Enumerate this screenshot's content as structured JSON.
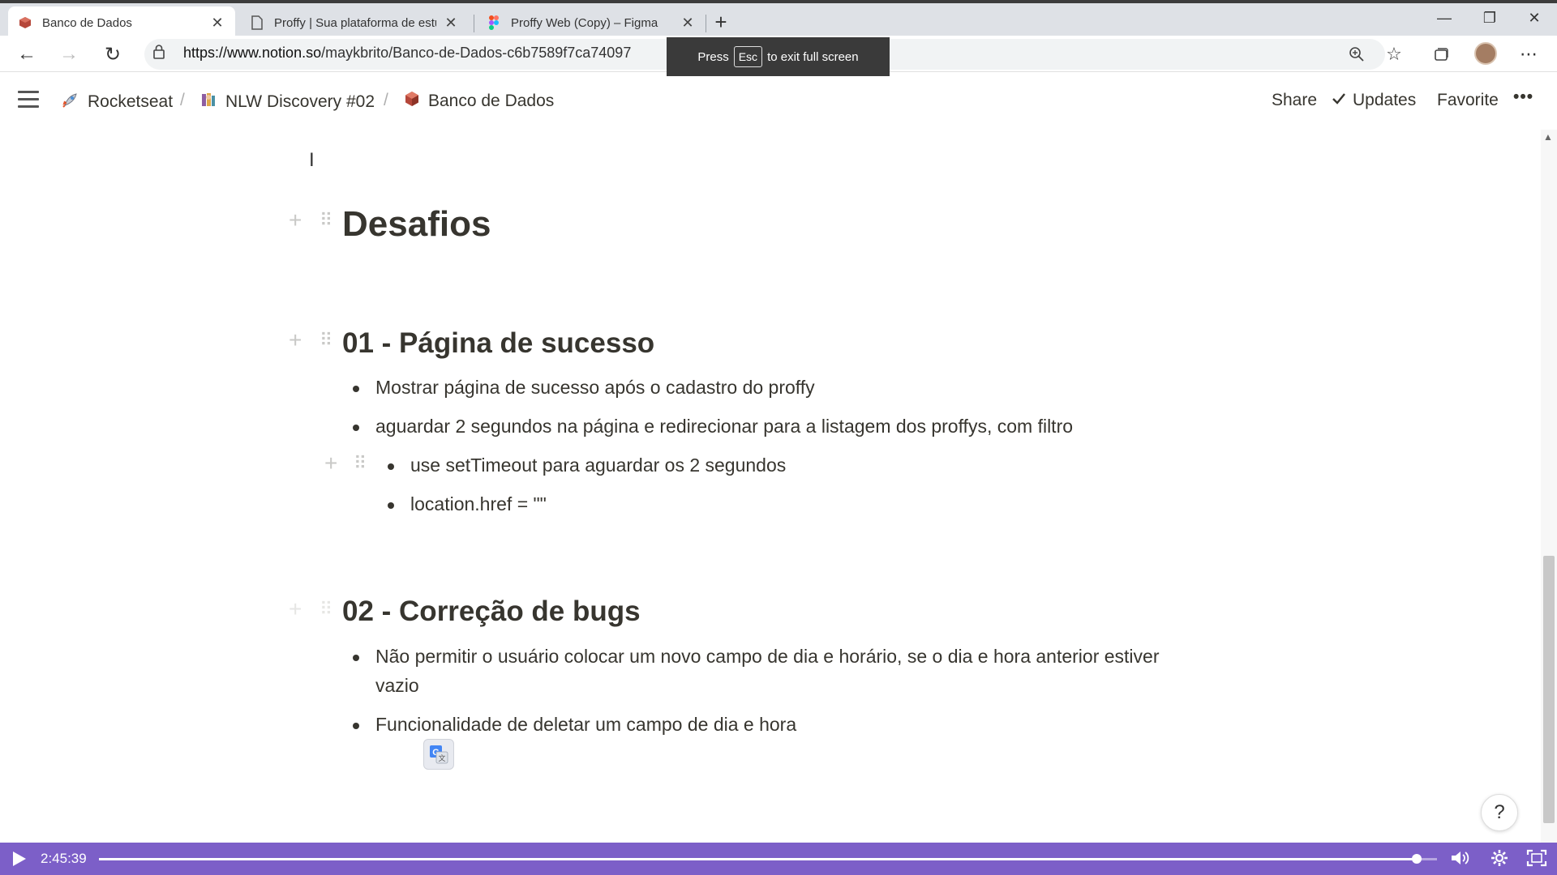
{
  "browser": {
    "tabs": [
      {
        "title": "Banco de Dados",
        "active": true,
        "icon": "notion-cube-icon"
      },
      {
        "title": "Proffy | Sua plataforma de estud…",
        "active": false,
        "icon": "page-icon"
      },
      {
        "title": "Proffy Web (Copy) – Figma",
        "active": false,
        "icon": "figma-icon"
      }
    ],
    "url_host": "https://www.notion.so",
    "url_path": "/maykbrito/Banco-de-Dados-c6b7589f7ca74097",
    "fullscreen_toast": {
      "press": "Press",
      "key": "Esc",
      "suffix": "to exit full screen"
    }
  },
  "notion": {
    "breadcrumb": [
      {
        "label": "Rocketseat",
        "icon": "rocket-icon"
      },
      {
        "label": "NLW Discovery #02",
        "icon": "books-icon"
      },
      {
        "label": "Banco de Dados",
        "icon": "cube-icon"
      }
    ],
    "actions": {
      "share": "Share",
      "updates": "Updates",
      "favorite": "Favorite",
      "more": "•••"
    }
  },
  "page": {
    "title": "Desafios",
    "sections": [
      {
        "heading": "01 - Página de sucesso",
        "items": [
          "Mostrar página de sucesso após o cadastro do proffy",
          "aguardar 2 segundos na página e redirecionar para a listagem dos proffys, com filtro"
        ],
        "subitems": [
          "use setTimeout para aguardar os 2 segundos",
          "location.href = \"\""
        ]
      },
      {
        "heading": "02 - Correção de bugs",
        "items": [
          "Não permitir o usuário colocar um novo campo de dia e horário, se o dia e hora anterior estiver",
          "Funcionalidade de deletar um campo de dia e hora"
        ],
        "item1_continuation": "vazio"
      }
    ],
    "help": "?"
  },
  "player": {
    "time": "2:45:39",
    "progress": 0.985
  },
  "colors": {
    "player_bg": "#7c5fc8",
    "text": "#37352f"
  }
}
